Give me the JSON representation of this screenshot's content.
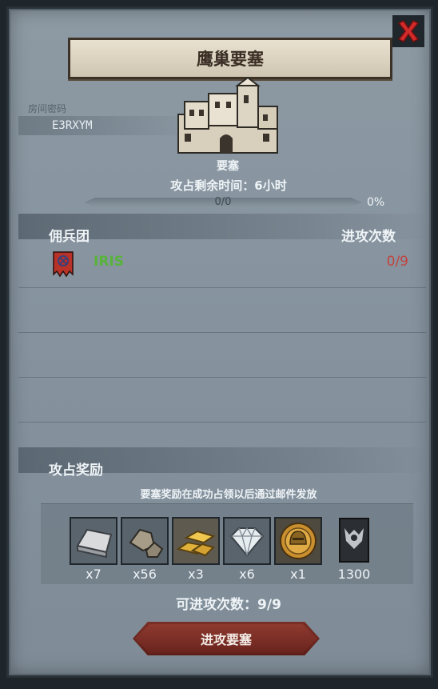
{
  "title": "鹰巢要塞",
  "room": {
    "label": "房间密码",
    "code": "E3RXYM"
  },
  "fortress": {
    "name": "要塞"
  },
  "time_left": "攻占剩余时间：6小时",
  "progress": {
    "text": "0/0",
    "percent": "0%",
    "fraction": 0
  },
  "table": {
    "col_left": "佣兵团",
    "col_right": "进攻次数",
    "rows": [
      {
        "name": "IRIS",
        "count": "0/9"
      }
    ]
  },
  "rewards": {
    "title": "攻占奖励",
    "note": "要塞奖励在成功占领以后通过邮件发放",
    "items": [
      {
        "icon": "silver-ingot-icon",
        "qty": "x7"
      },
      {
        "icon": "ore-icon",
        "qty": "x56"
      },
      {
        "icon": "gold-bars-icon",
        "qty": "x3"
      },
      {
        "icon": "diamond-icon",
        "qty": "x6"
      },
      {
        "icon": "helmet-medal-icon",
        "qty": "x1"
      },
      {
        "icon": "mercenary-token-icon",
        "qty": "1300"
      }
    ]
  },
  "attempts": "可进攻次数：9/9",
  "attack_button": "进攻要塞",
  "colors": {
    "accent": "#d6b15a",
    "guild_name": "#57b33a",
    "attack_count": "#c2433e",
    "close": "#d02a2a"
  }
}
